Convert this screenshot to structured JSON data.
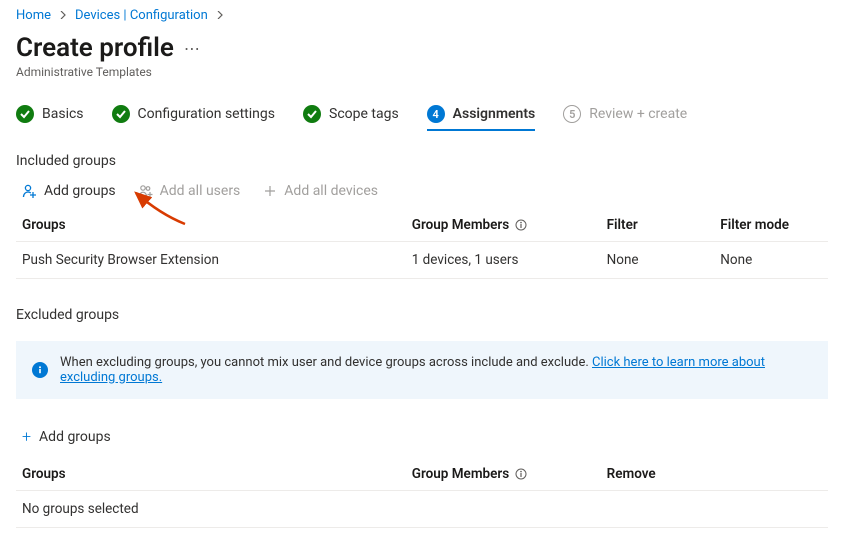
{
  "breadcrumb": {
    "home": "Home",
    "devices": "Devices | Configuration"
  },
  "header": {
    "title": "Create profile",
    "subtitle": "Administrative Templates"
  },
  "steps": {
    "s1": "Basics",
    "s2": "Configuration settings",
    "s3": "Scope tags",
    "s4_num": "4",
    "s4": "Assignments",
    "s5_num": "5",
    "s5": "Review + create"
  },
  "included": {
    "heading": "Included groups",
    "actions": {
      "add_groups": "Add groups",
      "add_all_users": "Add all users",
      "add_all_devices": "Add all devices"
    },
    "columns": {
      "groups": "Groups",
      "members": "Group Members",
      "filter": "Filter",
      "mode": "Filter mode"
    },
    "rows": [
      {
        "group": "Push Security Browser Extension",
        "members": "1 devices, 1 users",
        "filter": "None",
        "mode": "None"
      }
    ]
  },
  "excluded": {
    "heading": "Excluded groups",
    "banner": {
      "text": "When excluding groups, you cannot mix user and device groups across include and exclude. ",
      "link": "Click here to learn more about excluding groups."
    },
    "add_groups": "Add groups",
    "columns": {
      "groups": "Groups",
      "members": "Group Members",
      "remove": "Remove"
    },
    "empty": "No groups selected"
  }
}
